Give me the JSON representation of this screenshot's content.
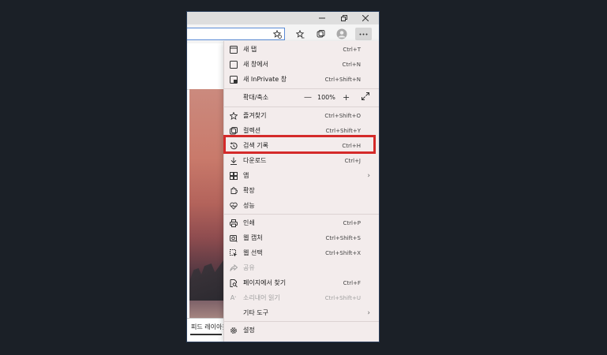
{
  "menu": {
    "items": [
      {
        "label": "새 탭",
        "shortcut": "Ctrl+T",
        "icon": "new-tab-icon"
      },
      {
        "label": "새 창에서",
        "shortcut": "Ctrl+N",
        "icon": "new-window-icon"
      },
      {
        "label": "새 InPrivate 창",
        "shortcut": "Ctrl+Shift+N",
        "icon": "inprivate-icon"
      },
      {
        "label": "확대/축소",
        "zoom": "100%"
      },
      {
        "label": "즐겨찾기",
        "shortcut": "Ctrl+Shift+O",
        "icon": "favorites-icon"
      },
      {
        "label": "컬렉션",
        "shortcut": "Ctrl+Shift+Y",
        "icon": "collections-icon"
      },
      {
        "label": "검색 기록",
        "shortcut": "Ctrl+H",
        "icon": "history-icon"
      },
      {
        "label": "다운로드",
        "shortcut": "Ctrl+J",
        "icon": "download-icon"
      },
      {
        "label": "앱",
        "icon": "apps-icon"
      },
      {
        "label": "확장",
        "icon": "extensions-icon"
      },
      {
        "label": "성능",
        "icon": "performance-icon"
      },
      {
        "label": "인쇄",
        "shortcut": "Ctrl+P",
        "icon": "print-icon"
      },
      {
        "label": "웹 캡처",
        "shortcut": "Ctrl+Shift+S",
        "icon": "web-capture-icon"
      },
      {
        "label": "웹 선택",
        "shortcut": "Ctrl+Shift+X",
        "icon": "web-select-icon"
      },
      {
        "label": "공유",
        "icon": "share-icon"
      },
      {
        "label": "페이지에서 찾기",
        "shortcut": "Ctrl+F",
        "icon": "find-icon"
      },
      {
        "label": "소리내어 읽기",
        "shortcut": "Ctrl+Shift+U",
        "icon": "read-aloud-icon"
      },
      {
        "label": "기타 도구",
        "icon": "more-tools-icon"
      },
      {
        "label": "설정",
        "icon": "settings-icon"
      }
    ]
  },
  "page": {
    "feed_label": "피드 레이아웃"
  },
  "colors": {
    "highlight": "#d42a2a",
    "background": "#1b2027",
    "menu_bg": "#f3ecec"
  }
}
